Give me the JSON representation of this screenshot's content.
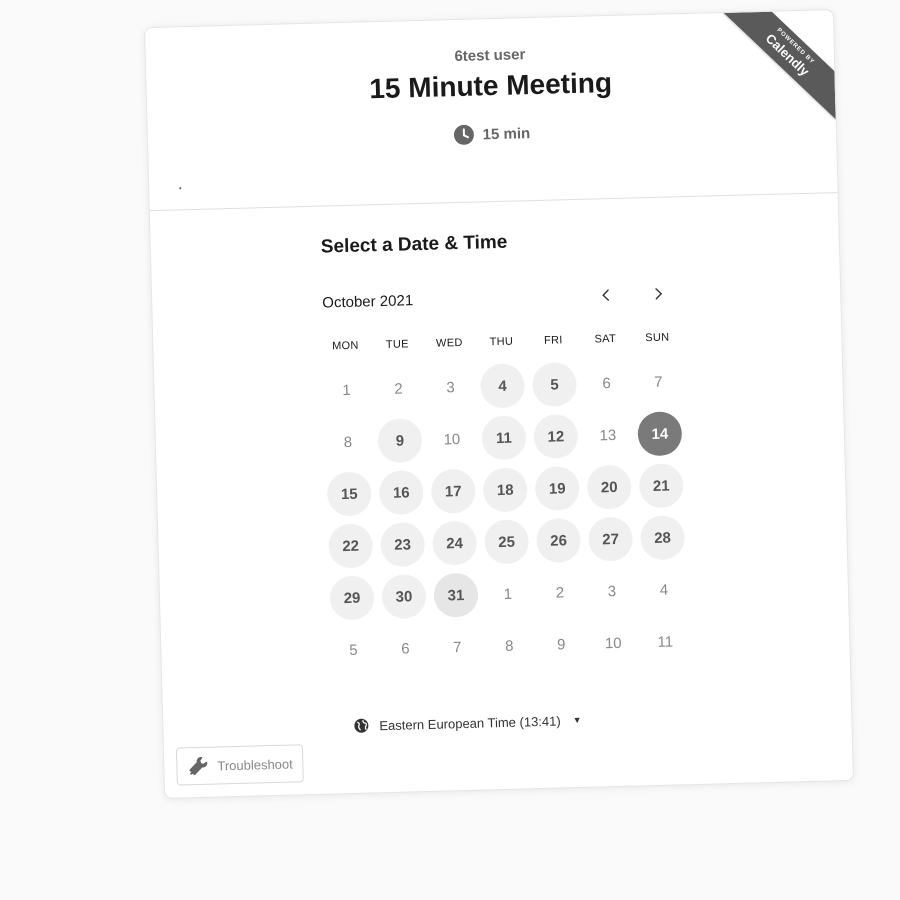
{
  "ribbon": {
    "small_text": "POWERED BY",
    "brand": "Calendly"
  },
  "header": {
    "host": "6test user",
    "title": "15 Minute Meeting",
    "duration": "15 min",
    "icon": "clock-icon"
  },
  "scheduler": {
    "title": "Select a Date & Time",
    "month": "October 2021",
    "prev_icon": "chevron-left-icon",
    "next_icon": "chevron-right-icon",
    "weekdays": [
      "MON",
      "TUE",
      "WED",
      "THU",
      "FRI",
      "SAT",
      "SUN"
    ],
    "weeks": [
      [
        {
          "label": "1",
          "state": "unavailable"
        },
        {
          "label": "2",
          "state": "unavailable"
        },
        {
          "label": "3",
          "state": "unavailable"
        },
        {
          "label": "4",
          "state": "available"
        },
        {
          "label": "5",
          "state": "available"
        },
        {
          "label": "6",
          "state": "unavailable"
        },
        {
          "label": "7",
          "state": "unavailable"
        }
      ],
      [
        {
          "label": "8",
          "state": "unavailable"
        },
        {
          "label": "9",
          "state": "available"
        },
        {
          "label": "10",
          "state": "unavailable"
        },
        {
          "label": "11",
          "state": "available"
        },
        {
          "label": "12",
          "state": "available"
        },
        {
          "label": "13",
          "state": "unavailable"
        },
        {
          "label": "14",
          "state": "selected"
        }
      ],
      [
        {
          "label": "15",
          "state": "available"
        },
        {
          "label": "16",
          "state": "available"
        },
        {
          "label": "17",
          "state": "available"
        },
        {
          "label": "18",
          "state": "available"
        },
        {
          "label": "19",
          "state": "available"
        },
        {
          "label": "20",
          "state": "available"
        },
        {
          "label": "21",
          "state": "available"
        }
      ],
      [
        {
          "label": "22",
          "state": "available"
        },
        {
          "label": "23",
          "state": "available"
        },
        {
          "label": "24",
          "state": "available"
        },
        {
          "label": "25",
          "state": "available"
        },
        {
          "label": "26",
          "state": "available"
        },
        {
          "label": "27",
          "state": "available"
        },
        {
          "label": "28",
          "state": "available"
        }
      ],
      [
        {
          "label": "29",
          "state": "available"
        },
        {
          "label": "30",
          "state": "available"
        },
        {
          "label": "31",
          "state": "hover"
        },
        {
          "label": "1",
          "state": "unavailable"
        },
        {
          "label": "2",
          "state": "unavailable"
        },
        {
          "label": "3",
          "state": "unavailable"
        },
        {
          "label": "4",
          "state": "unavailable"
        }
      ],
      [
        {
          "label": "5",
          "state": "unavailable"
        },
        {
          "label": "6",
          "state": "unavailable"
        },
        {
          "label": "7",
          "state": "unavailable"
        },
        {
          "label": "8",
          "state": "unavailable"
        },
        {
          "label": "9",
          "state": "unavailable"
        },
        {
          "label": "10",
          "state": "unavailable"
        },
        {
          "label": "11",
          "state": "unavailable"
        }
      ]
    ],
    "timezone": "Eastern European Time (13:41)",
    "timezone_icon": "globe-icon"
  },
  "footer": {
    "troubleshoot_label": "Troubleshoot",
    "troubleshoot_icon": "wrench-icon"
  },
  "colors": {
    "selected_day": "#7a7a7a",
    "available_day": "#f0f0f0",
    "ribbon": "#5a5a5a"
  }
}
